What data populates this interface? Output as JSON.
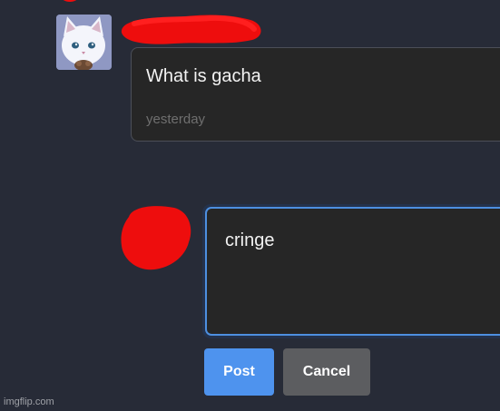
{
  "comment": {
    "text": "What is gacha",
    "time": "yesterday"
  },
  "reply": {
    "value": "cringe"
  },
  "buttons": {
    "post_label": "Post",
    "cancel_label": "Cancel"
  },
  "watermark": "imgflip.com",
  "colors": {
    "background": "#272b37",
    "card": "#262626",
    "accent": "#4e93ee",
    "cancel": "#5c5d60",
    "redaction": "#ee0d0d"
  },
  "icons": {
    "avatar": "white-cat-avatar"
  }
}
